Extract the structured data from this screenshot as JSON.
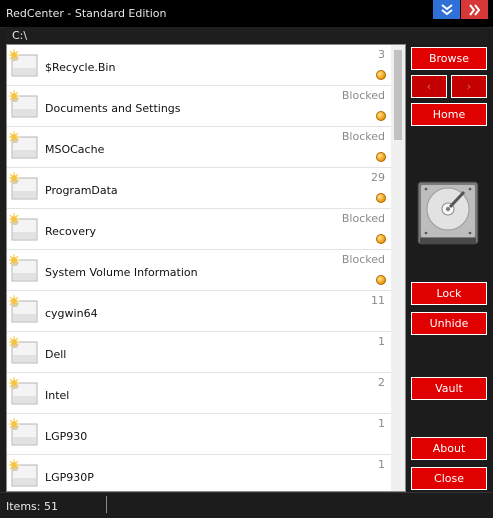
{
  "window": {
    "title": "RedCenter - Standard Edition"
  },
  "titlebar_buttons": [
    {
      "name": "minimize-button",
      "icon": "double-chevron-down-icon",
      "color": "#2e6fd8"
    },
    {
      "name": "close-window-button",
      "icon": "double-chevron-right-icon",
      "color": "#d63737"
    }
  ],
  "path": {
    "current": "C:\\"
  },
  "files": [
    {
      "name": "$Recycle.Bin",
      "count": "3",
      "dot": true
    },
    {
      "name": "Documents and Settings",
      "count": "Blocked",
      "dot": true
    },
    {
      "name": "MSOCache",
      "count": "Blocked",
      "dot": true
    },
    {
      "name": "ProgramData",
      "count": "29",
      "dot": true
    },
    {
      "name": "Recovery",
      "count": "Blocked",
      "dot": true
    },
    {
      "name": "System Volume Information",
      "count": "Blocked",
      "dot": true
    },
    {
      "name": "cygwin64",
      "count": "11",
      "dot": false
    },
    {
      "name": "Dell",
      "count": "1",
      "dot": false
    },
    {
      "name": "Intel",
      "count": "2",
      "dot": false
    },
    {
      "name": "LGP930",
      "count": "1",
      "dot": false
    },
    {
      "name": "LGP930P",
      "count": "1",
      "dot": false
    }
  ],
  "buttons": {
    "browse": "Browse",
    "back": "‹",
    "forward": "›",
    "home": "Home",
    "lock": "Lock",
    "unhide": "Unhide",
    "vault": "Vault",
    "about": "About",
    "close": "Close"
  },
  "drive_icon": "hard-drive-icon",
  "status": {
    "items": "Items: 51"
  },
  "colors": {
    "accent": "#e00000",
    "background": "#1c1c1c",
    "dot": "#f5a623"
  }
}
